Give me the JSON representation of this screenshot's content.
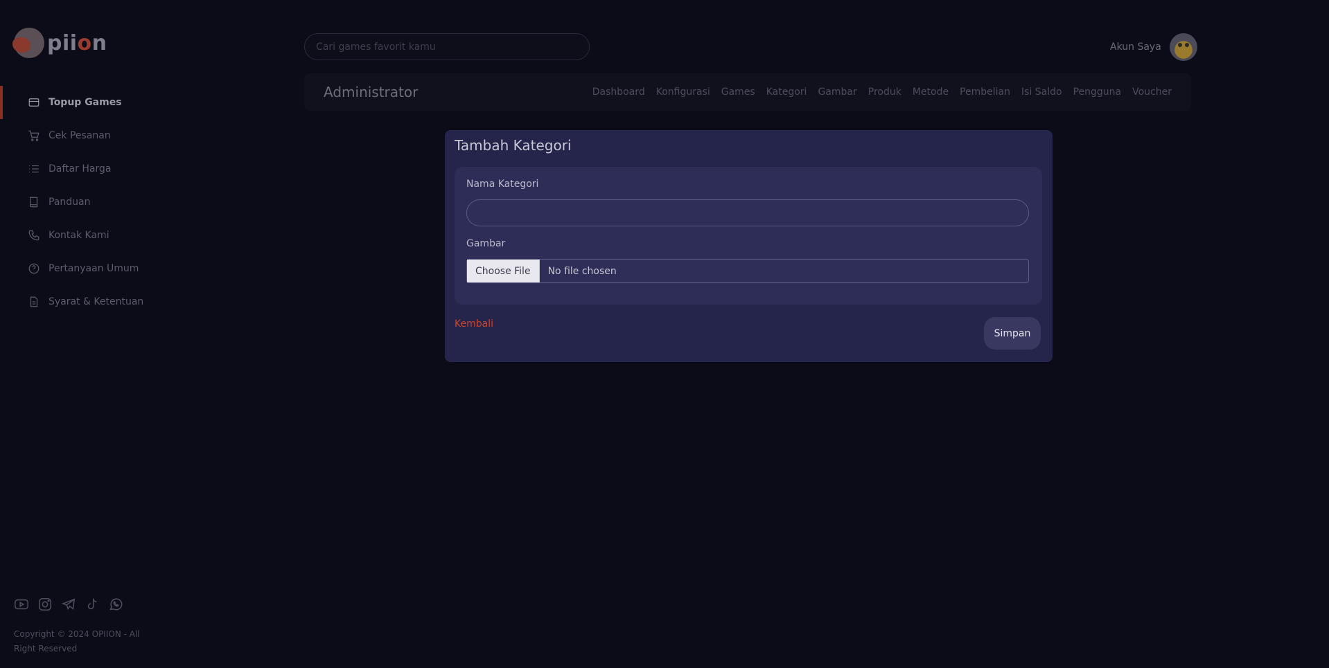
{
  "brand": {
    "logo_text_pre": "pii",
    "logo_text_o": "o",
    "logo_text_post": "n"
  },
  "sidebar": {
    "items": [
      {
        "label": "Topup Games",
        "icon": "card-icon",
        "active": true
      },
      {
        "label": "Cek Pesanan",
        "icon": "cart-icon",
        "active": false
      },
      {
        "label": "Daftar Harga",
        "icon": "list-icon",
        "active": false
      },
      {
        "label": "Panduan",
        "icon": "book-icon",
        "active": false
      },
      {
        "label": "Kontak Kami",
        "icon": "phone-icon",
        "active": false
      },
      {
        "label": "Pertanyaan Umum",
        "icon": "question-icon",
        "active": false
      },
      {
        "label": "Syarat & Ketentuan",
        "icon": "document-icon",
        "active": false
      }
    ],
    "socials": [
      "youtube-icon",
      "instagram-icon",
      "telegram-icon",
      "tiktok-icon",
      "whatsapp-icon"
    ],
    "copyright": "Copyright © 2024 OPIION - All Right Reserved"
  },
  "header": {
    "search_placeholder": "Cari games favorit kamu",
    "account_label": "Akun Saya"
  },
  "admin": {
    "title": "Administrator",
    "links": [
      "Dashboard",
      "Konfigurasi",
      "Games",
      "Kategori",
      "Gambar",
      "Produk",
      "Metode",
      "Pembelian",
      "Isi Saldo",
      "Pengguna",
      "Voucher"
    ]
  },
  "form": {
    "title": "Tambah Kategori",
    "name_label": "Nama Kategori",
    "name_value": "",
    "image_label": "Gambar",
    "file_button": "Choose File",
    "file_status": "No file chosen",
    "back_label": "Kembali",
    "save_label": "Simpan"
  },
  "colors": {
    "accent": "#8b2f25",
    "back_link": "#c9452f",
    "card_bg": "#25244b"
  }
}
